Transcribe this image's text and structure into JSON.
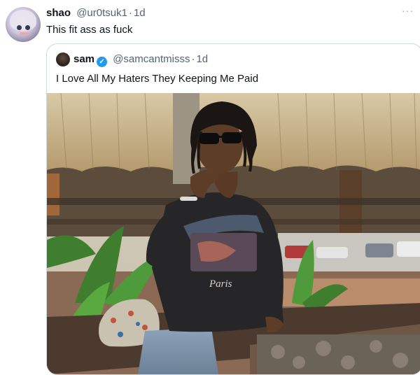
{
  "tweet": {
    "display_name": "shao",
    "handle": "@ur0tsuk1",
    "separator": "·",
    "timestamp": "1d",
    "text": "This fit ass as fuck",
    "more_icon": "ellipsis-icon"
  },
  "quoted_tweet": {
    "display_name": "sam",
    "handle": "@samcantmisss",
    "separator": "·",
    "timestamp": "1d",
    "verified": true,
    "verified_icon": "verified-badge-icon",
    "text": "I Love All My Haters They Keeping Me Paid",
    "media_text": "Paris"
  },
  "colors": {
    "text_primary": "#0f1419",
    "text_secondary": "#536471",
    "border": "#cfd9de",
    "verified": "#1d9bf0"
  }
}
